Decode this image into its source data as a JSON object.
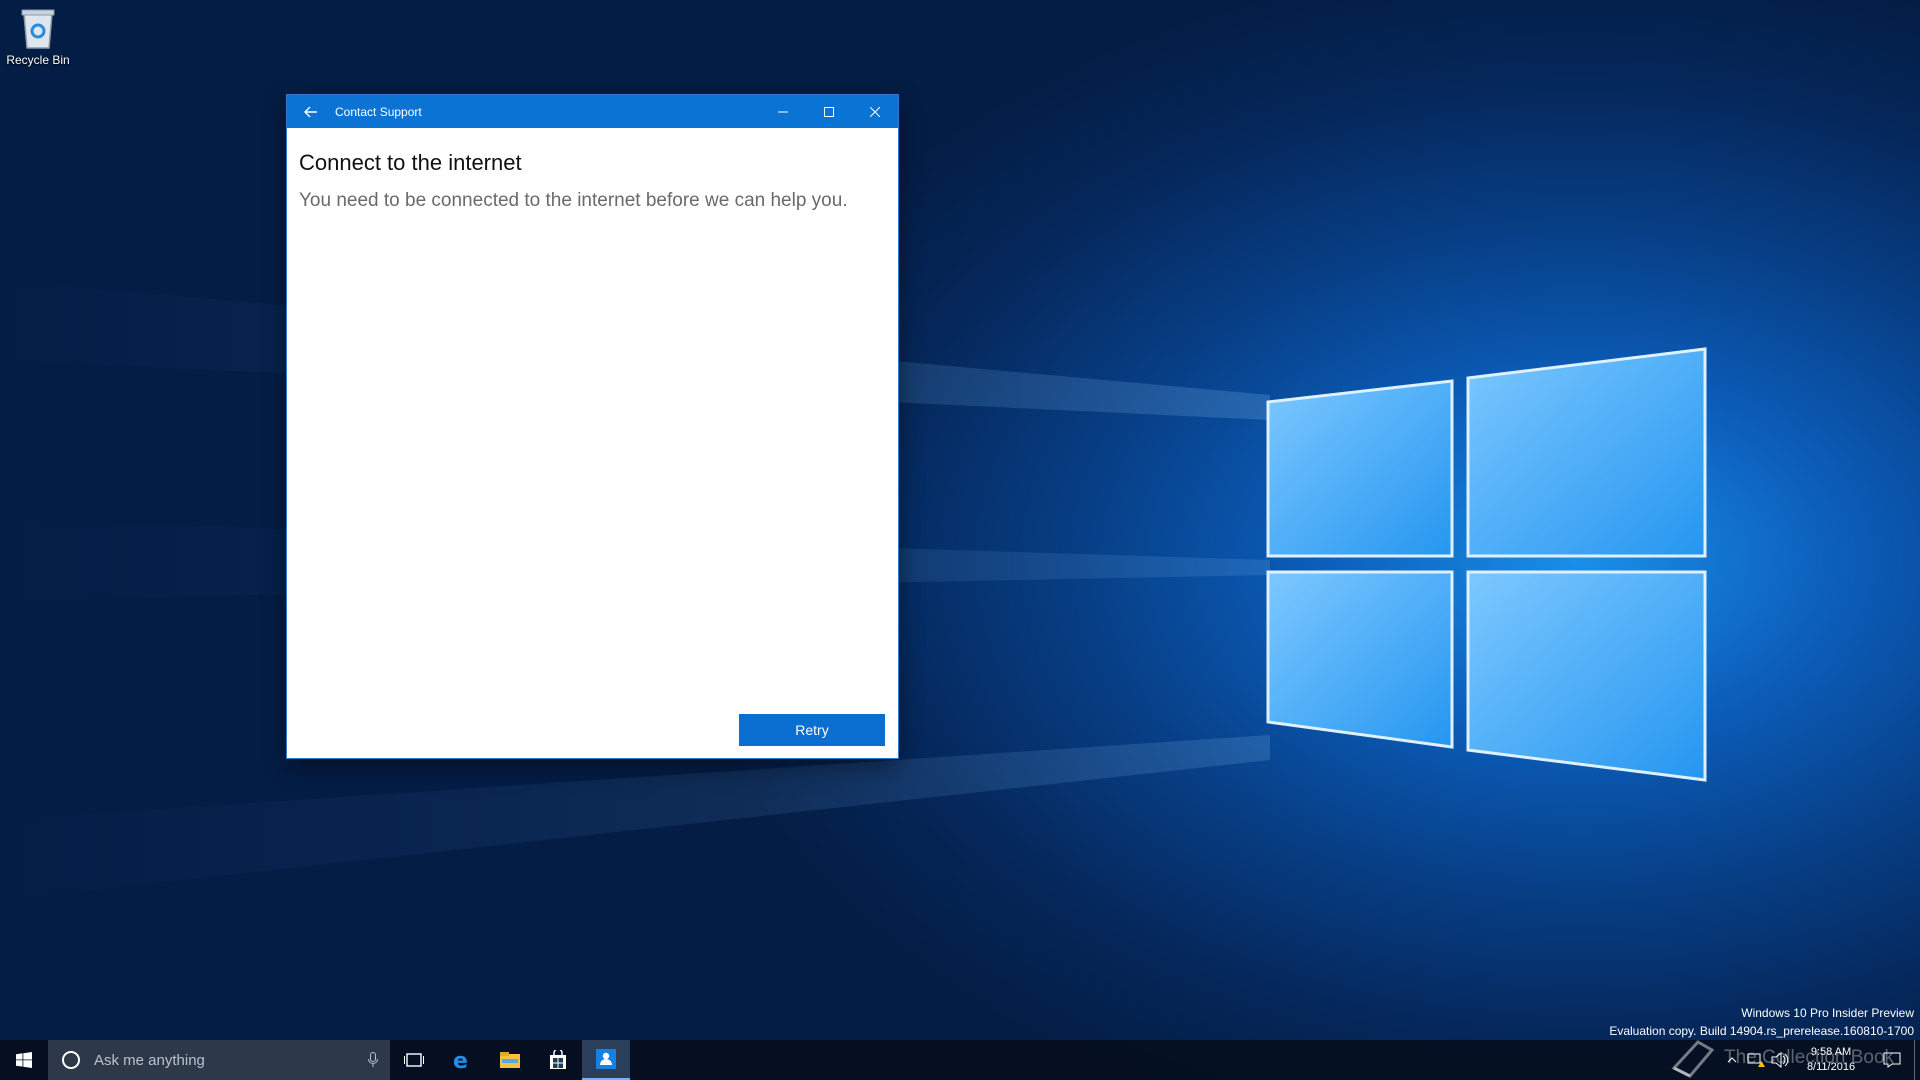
{
  "desktop": {
    "recycle_bin_label": "Recycle Bin"
  },
  "window": {
    "title": "Contact Support",
    "heading": "Connect to the internet",
    "message": "You need to be connected to the internet before we can help you.",
    "retry_label": "Retry",
    "accent_color": "#0a73d4"
  },
  "watermark": {
    "line1": "Windows 10 Pro Insider Preview",
    "line2": "Evaluation copy. Build 14904.rs_prerelease.160810-1700",
    "collection_text": "The Collection Book"
  },
  "taskbar": {
    "search_placeholder": "Ask me anything",
    "apps": [
      "task-view-icon",
      "edge-icon",
      "file-explorer-icon",
      "store-icon",
      "contact-support-icon"
    ],
    "time": "9:58 AM",
    "date": "8/11/2016"
  }
}
